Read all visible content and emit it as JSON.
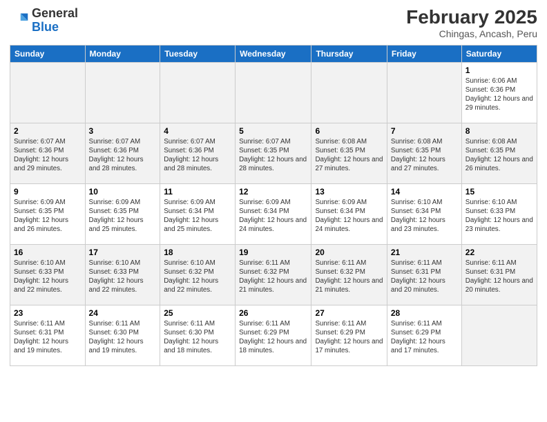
{
  "header": {
    "logo_general": "General",
    "logo_blue": "Blue",
    "main_title": "February 2025",
    "subtitle": "Chingas, Ancash, Peru"
  },
  "days_of_week": [
    "Sunday",
    "Monday",
    "Tuesday",
    "Wednesday",
    "Thursday",
    "Friday",
    "Saturday"
  ],
  "weeks": [
    [
      {
        "day": "",
        "info": ""
      },
      {
        "day": "",
        "info": ""
      },
      {
        "day": "",
        "info": ""
      },
      {
        "day": "",
        "info": ""
      },
      {
        "day": "",
        "info": ""
      },
      {
        "day": "",
        "info": ""
      },
      {
        "day": "1",
        "info": "Sunrise: 6:06 AM\nSunset: 6:36 PM\nDaylight: 12 hours and 29 minutes."
      }
    ],
    [
      {
        "day": "2",
        "info": "Sunrise: 6:07 AM\nSunset: 6:36 PM\nDaylight: 12 hours and 29 minutes."
      },
      {
        "day": "3",
        "info": "Sunrise: 6:07 AM\nSunset: 6:36 PM\nDaylight: 12 hours and 28 minutes."
      },
      {
        "day": "4",
        "info": "Sunrise: 6:07 AM\nSunset: 6:36 PM\nDaylight: 12 hours and 28 minutes."
      },
      {
        "day": "5",
        "info": "Sunrise: 6:07 AM\nSunset: 6:35 PM\nDaylight: 12 hours and 28 minutes."
      },
      {
        "day": "6",
        "info": "Sunrise: 6:08 AM\nSunset: 6:35 PM\nDaylight: 12 hours and 27 minutes."
      },
      {
        "day": "7",
        "info": "Sunrise: 6:08 AM\nSunset: 6:35 PM\nDaylight: 12 hours and 27 minutes."
      },
      {
        "day": "8",
        "info": "Sunrise: 6:08 AM\nSunset: 6:35 PM\nDaylight: 12 hours and 26 minutes."
      }
    ],
    [
      {
        "day": "9",
        "info": "Sunrise: 6:09 AM\nSunset: 6:35 PM\nDaylight: 12 hours and 26 minutes."
      },
      {
        "day": "10",
        "info": "Sunrise: 6:09 AM\nSunset: 6:35 PM\nDaylight: 12 hours and 25 minutes."
      },
      {
        "day": "11",
        "info": "Sunrise: 6:09 AM\nSunset: 6:34 PM\nDaylight: 12 hours and 25 minutes."
      },
      {
        "day": "12",
        "info": "Sunrise: 6:09 AM\nSunset: 6:34 PM\nDaylight: 12 hours and 24 minutes."
      },
      {
        "day": "13",
        "info": "Sunrise: 6:09 AM\nSunset: 6:34 PM\nDaylight: 12 hours and 24 minutes."
      },
      {
        "day": "14",
        "info": "Sunrise: 6:10 AM\nSunset: 6:34 PM\nDaylight: 12 hours and 23 minutes."
      },
      {
        "day": "15",
        "info": "Sunrise: 6:10 AM\nSunset: 6:33 PM\nDaylight: 12 hours and 23 minutes."
      }
    ],
    [
      {
        "day": "16",
        "info": "Sunrise: 6:10 AM\nSunset: 6:33 PM\nDaylight: 12 hours and 22 minutes."
      },
      {
        "day": "17",
        "info": "Sunrise: 6:10 AM\nSunset: 6:33 PM\nDaylight: 12 hours and 22 minutes."
      },
      {
        "day": "18",
        "info": "Sunrise: 6:10 AM\nSunset: 6:32 PM\nDaylight: 12 hours and 22 minutes."
      },
      {
        "day": "19",
        "info": "Sunrise: 6:11 AM\nSunset: 6:32 PM\nDaylight: 12 hours and 21 minutes."
      },
      {
        "day": "20",
        "info": "Sunrise: 6:11 AM\nSunset: 6:32 PM\nDaylight: 12 hours and 21 minutes."
      },
      {
        "day": "21",
        "info": "Sunrise: 6:11 AM\nSunset: 6:31 PM\nDaylight: 12 hours and 20 minutes."
      },
      {
        "day": "22",
        "info": "Sunrise: 6:11 AM\nSunset: 6:31 PM\nDaylight: 12 hours and 20 minutes."
      }
    ],
    [
      {
        "day": "23",
        "info": "Sunrise: 6:11 AM\nSunset: 6:31 PM\nDaylight: 12 hours and 19 minutes."
      },
      {
        "day": "24",
        "info": "Sunrise: 6:11 AM\nSunset: 6:30 PM\nDaylight: 12 hours and 19 minutes."
      },
      {
        "day": "25",
        "info": "Sunrise: 6:11 AM\nSunset: 6:30 PM\nDaylight: 12 hours and 18 minutes."
      },
      {
        "day": "26",
        "info": "Sunrise: 6:11 AM\nSunset: 6:29 PM\nDaylight: 12 hours and 18 minutes."
      },
      {
        "day": "27",
        "info": "Sunrise: 6:11 AM\nSunset: 6:29 PM\nDaylight: 12 hours and 17 minutes."
      },
      {
        "day": "28",
        "info": "Sunrise: 6:11 AM\nSunset: 6:29 PM\nDaylight: 12 hours and 17 minutes."
      },
      {
        "day": "",
        "info": ""
      }
    ]
  ]
}
